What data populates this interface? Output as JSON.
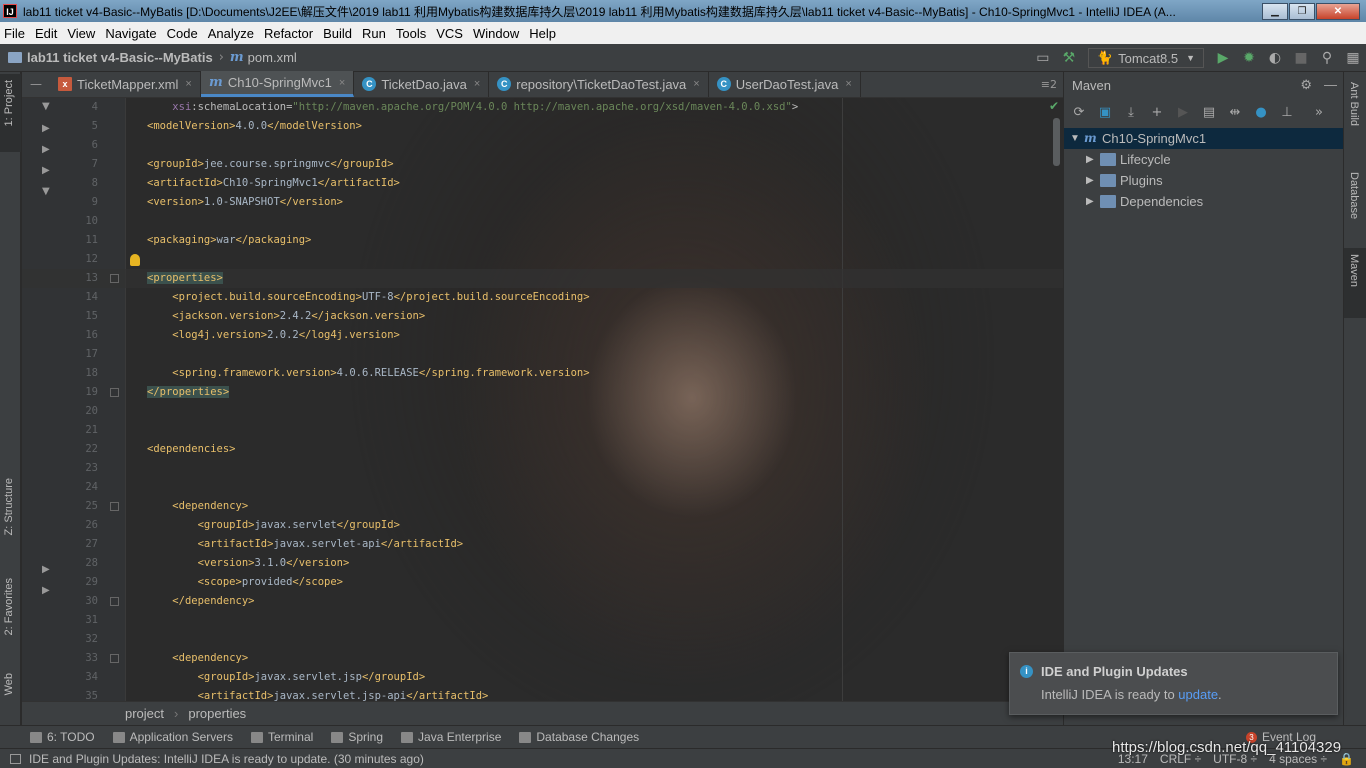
{
  "window": {
    "title": "lab11 ticket v4-Basic--MyBatis [D:\\Documents\\J2EE\\解压文件\\2019 lab11 利用Mybatis构建数据库持久层\\2019 lab11 利用Mybatis构建数据库持久层\\lab11 ticket v4-Basic--MyBatis] - Ch10-SpringMvc1 - IntelliJ IDEA (A..."
  },
  "menu": [
    "File",
    "Edit",
    "View",
    "Navigate",
    "Code",
    "Analyze",
    "Refactor",
    "Build",
    "Run",
    "Tools",
    "VCS",
    "Window",
    "Help"
  ],
  "nav": {
    "project": "lab11 ticket v4-Basic--MyBatis",
    "file": "pom.xml"
  },
  "run_config": "Tomcat8.5",
  "left_strip": {
    "project": "1: Project",
    "structure": "Z: Structure",
    "favorites": "2: Favorites",
    "web": "Web"
  },
  "tabs": [
    {
      "label": "TicketMapper.xml",
      "icon": "xml-file-icon"
    },
    {
      "label": "Ch10-SpringMvc1",
      "icon": "maven-icon",
      "active": true
    },
    {
      "label": "TicketDao.java",
      "icon": "class-icon"
    },
    {
      "label": "repository\\TicketDaoTest.java",
      "icon": "class-icon"
    },
    {
      "label": "UserDaoTest.java",
      "icon": "class-icon"
    }
  ],
  "tab_overflow": "≡2",
  "editor": {
    "lines": [
      {
        "n": "4",
        "text": "    xsi:schemaLocation=\"http://maven.apache.org/POM/4.0.0 http://maven.apache.org/xsd/maven-4.0.0.xsd\">"
      },
      {
        "n": "5",
        "text": "<modelVersion>4.0.0</modelVersion>"
      },
      {
        "n": "6",
        "text": ""
      },
      {
        "n": "7",
        "text": "<groupId>jee.course.springmvc</groupId>"
      },
      {
        "n": "8",
        "text": "<artifactId>Ch10-SpringMvc1</artifactId>"
      },
      {
        "n": "9",
        "text": "<version>1.0-SNAPSHOT</version>"
      },
      {
        "n": "10",
        "text": ""
      },
      {
        "n": "11",
        "text": "<packaging>war</packaging>"
      },
      {
        "n": "12",
        "text": ""
      },
      {
        "n": "13",
        "text": "<properties>"
      },
      {
        "n": "14",
        "text": "    <project.build.sourceEncoding>UTF-8</project.build.sourceEncoding>"
      },
      {
        "n": "15",
        "text": "    <jackson.version>2.4.2</jackson.version>"
      },
      {
        "n": "16",
        "text": "    <log4j.version>2.0.2</log4j.version>"
      },
      {
        "n": "17",
        "text": ""
      },
      {
        "n": "18",
        "text": "    <spring.framework.version>4.0.6.RELEASE</spring.framework.version>"
      },
      {
        "n": "19",
        "text": "</properties>"
      },
      {
        "n": "20",
        "text": ""
      },
      {
        "n": "21",
        "text": ""
      },
      {
        "n": "22",
        "text": "<dependencies>"
      },
      {
        "n": "23",
        "text": ""
      },
      {
        "n": "24",
        "text": ""
      },
      {
        "n": "25",
        "text": "    <dependency>"
      },
      {
        "n": "26",
        "text": "        <groupId>javax.servlet</groupId>"
      },
      {
        "n": "27",
        "text": "        <artifactId>javax.servlet-api</artifactId>"
      },
      {
        "n": "28",
        "text": "        <version>3.1.0</version>"
      },
      {
        "n": "29",
        "text": "        <scope>provided</scope>"
      },
      {
        "n": "30",
        "text": "    </dependency>"
      },
      {
        "n": "31",
        "text": ""
      },
      {
        "n": "32",
        "text": ""
      },
      {
        "n": "33",
        "text": "    <dependency>"
      },
      {
        "n": "34",
        "text": "        <groupId>javax.servlet.jsp</groupId>"
      },
      {
        "n": "35",
        "text": "        <artifactId>javax.servlet.jsp-api</artifactId>"
      }
    ]
  },
  "breadcrumb": [
    "project",
    "properties"
  ],
  "maven": {
    "title": "Maven",
    "root": "Ch10-SpringMvc1",
    "children": [
      "Lifecycle",
      "Plugins",
      "Dependencies"
    ]
  },
  "right_strip": {
    "ant": "Ant Build",
    "database": "Database",
    "maven": "Maven"
  },
  "notification": {
    "title": "IDE and Plugin Updates",
    "body_prefix": "IntelliJ IDEA is ready to ",
    "link": "update",
    "body_suffix": "."
  },
  "toolwindows": [
    "6: TODO",
    "Application Servers",
    "Terminal",
    "Spring",
    "Java Enterprise",
    "Database Changes"
  ],
  "event_log": {
    "label": "Event Log",
    "count": "3"
  },
  "status": {
    "message": "IDE and Plugin Updates: IntelliJ IDEA is ready to update. (30 minutes ago)",
    "position": "13:17",
    "line_sep": "CRLF ÷",
    "encoding": "UTF-8 ÷",
    "indent": "4 spaces ÷"
  },
  "watermark": "https://blog.csdn.net/qq_41104329",
  "colors": {
    "tag": "#e8bf6a",
    "accent": "#4a88c7",
    "link": "#589df6",
    "run": "#59a869"
  }
}
